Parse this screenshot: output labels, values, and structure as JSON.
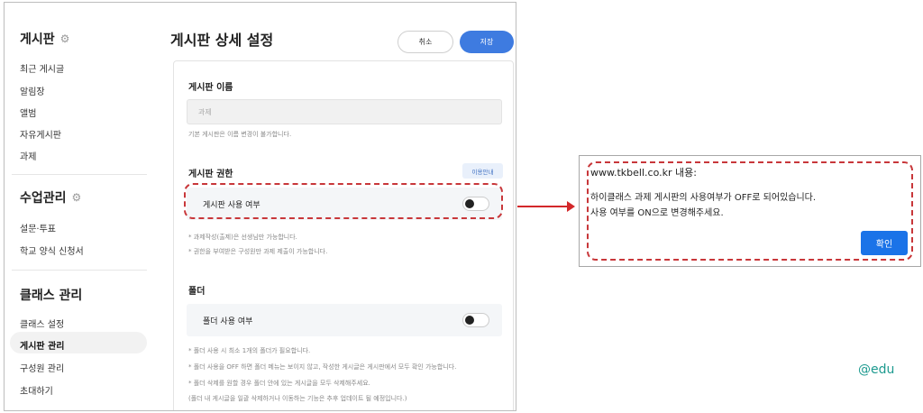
{
  "sidebar": {
    "sections": [
      {
        "title": "게시판",
        "items": [
          "최근 게시글",
          "알림장",
          "앨범",
          "자유게시판",
          "과제"
        ]
      },
      {
        "title": "수업관리",
        "items": [
          "설문·투표",
          "학교 양식 신청서"
        ]
      },
      {
        "title": "클래스 관리",
        "items": [
          "클래스 설정",
          "게시판 관리",
          "구성원 관리",
          "초대하기"
        ]
      }
    ],
    "active_item": "게시판 관리"
  },
  "main": {
    "title": "게시판 상세 설정",
    "cancel_label": "취소",
    "save_label": "저장",
    "board_name_label": "게시판 이름",
    "board_name_value": "과제",
    "board_name_help": "기본 게시판은 이름 변경이 불가합니다.",
    "permission_label": "게시판 권한",
    "guide_label": "이용안내",
    "board_use_label": "게시판 사용 여부",
    "board_use_on": false,
    "permission_help1": "* 과제작성(출제)은 선생님만 가능합니다.",
    "permission_help2": "* 권한을 부여받은 구성원만 과제 제출이 가능합니다.",
    "folder_label": "폴더",
    "folder_use_label": "폴더 사용 여부",
    "folder_use_on": false,
    "folder_help1": "* 폴더 사용 시 최소 1개의 폴더가 필요합니다.",
    "folder_help2": "* 폴더 사용을 OFF 하면 폴더 메뉴는 보이지 않고, 작성한 게시글은 게시판에서 모두 확인 가능합니다.",
    "folder_help3": "* 폴더 삭제를 원할 경우 폴더 안에 있는 게시글을 모두 삭제해주세요.",
    "folder_help4": "(폴더 내 게시글을 일괄 삭제하거나 이동하는 기능은 추후 업데이트 될 예정입니다.)"
  },
  "alert": {
    "title": "www.tkbell.co.kr 내용:",
    "message_line1": "하이클래스 과제 게시판의 사용여부가 OFF로 되어있습니다.",
    "message_line2": "사용 여부를 ON으로 변경해주세요.",
    "ok_label": "확인"
  },
  "watermark": "@edu",
  "colors": {
    "accent": "#3e7be0",
    "annotation_red": "#c8373a",
    "alert_button": "#1a73e8",
    "watermark": "#1d9a8f"
  }
}
